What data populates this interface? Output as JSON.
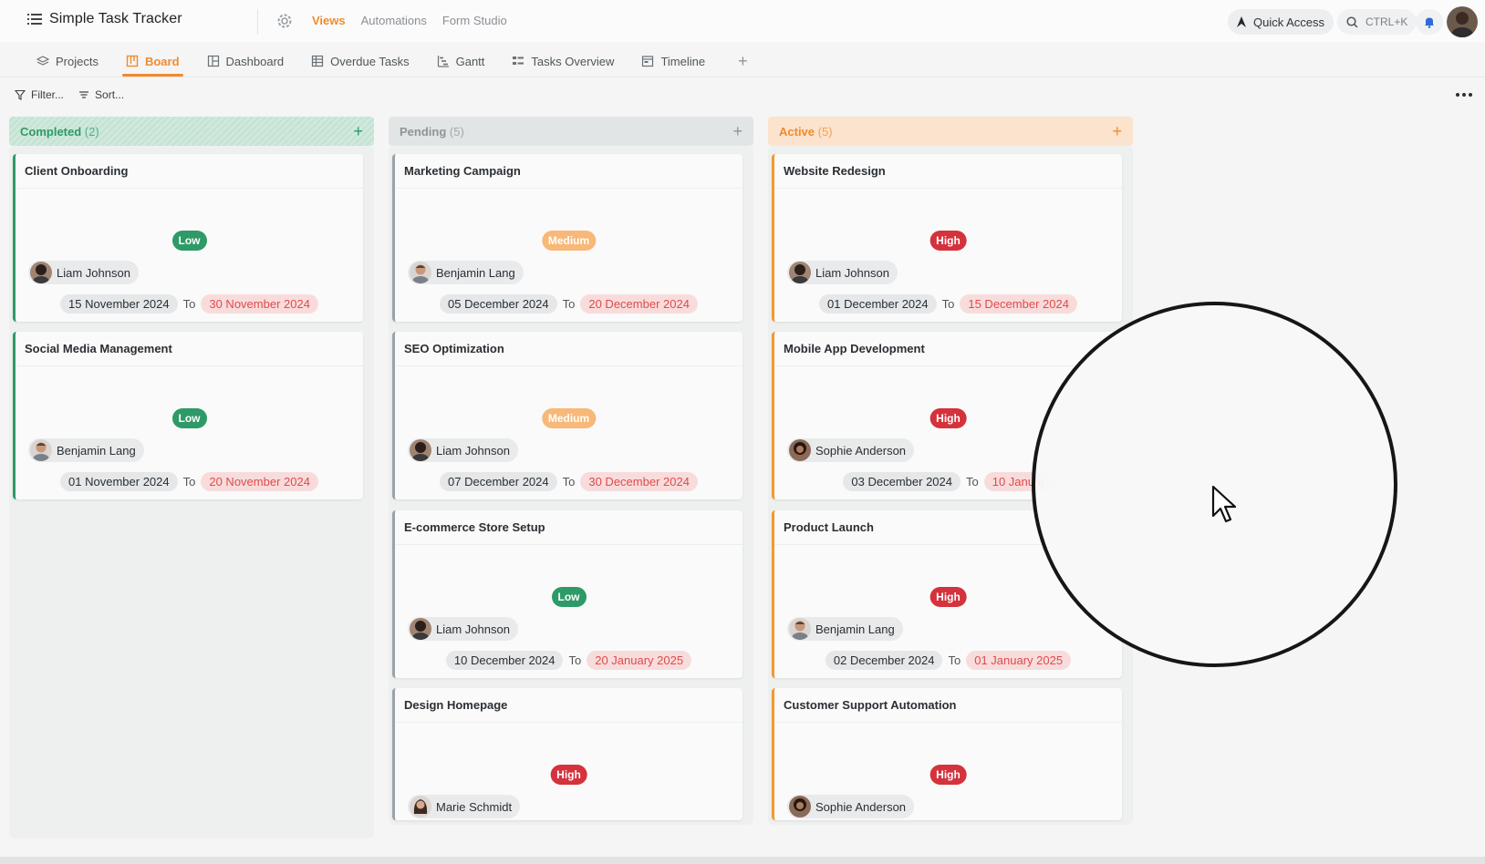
{
  "app": {
    "title": "Simple Task Tracker"
  },
  "topnav": [
    "Views",
    "Automations",
    "Form Studio"
  ],
  "header": {
    "quick_access": "Quick Access",
    "search_shortcut": "CTRL+K"
  },
  "tabs": [
    "Projects",
    "Board",
    "Dashboard",
    "Overdue Tasks",
    "Gantt",
    "Tasks Overview",
    "Timeline"
  ],
  "toolbar": {
    "filter": "Filter...",
    "sort": "Sort..."
  },
  "columns": [
    {
      "name": "Completed",
      "count": "(2)"
    },
    {
      "name": "Pending",
      "count": "(5)"
    },
    {
      "name": "Active",
      "count": "(5)"
    }
  ],
  "date_separator": "To",
  "cards": {
    "completed": [
      {
        "title": "Client Onboarding",
        "priority": "Low",
        "assignee": "Liam Johnson",
        "start": "15 November 2024",
        "end": "30 November 2024"
      },
      {
        "title": "Social Media Management",
        "priority": "Low",
        "assignee": "Benjamin Lang",
        "start": "01 November 2024",
        "end": "20 November 2024"
      }
    ],
    "pending": [
      {
        "title": "Marketing Campaign",
        "priority": "Medium",
        "assignee": "Benjamin Lang",
        "start": "05 December 2024",
        "end": "20 December 2024"
      },
      {
        "title": "SEO Optimization",
        "priority": "Medium",
        "assignee": "Liam Johnson",
        "start": "07 December 2024",
        "end": "30 December 2024"
      },
      {
        "title": "E-commerce Store Setup",
        "priority": "Low",
        "assignee": "Liam Johnson",
        "start": "10 December 2024",
        "end": "20 January 2025"
      },
      {
        "title": "Design Homepage",
        "priority": "High",
        "assignee": "Marie Schmidt"
      }
    ],
    "active": [
      {
        "title": "Website Redesign",
        "priority": "High",
        "assignee": "Liam Johnson",
        "start": "01 December 2024",
        "end": "15 December 2024"
      },
      {
        "title": "Mobile App Development",
        "priority": "High",
        "assignee": "Sophie Anderson",
        "start": "03 December 2024",
        "end": "10 Januar"
      },
      {
        "title": "Product Launch",
        "priority": "High",
        "assignee": "Benjamin Lang",
        "start": "02 December 2024",
        "end": "01 January 2025"
      },
      {
        "title": "Customer Support Automation",
        "priority": "High",
        "assignee": "Sophie Anderson"
      }
    ]
  },
  "colors": {
    "accent": "#f28a2e",
    "low": "#2e9a67",
    "medium": "#f7b878",
    "high": "#d4323c"
  }
}
